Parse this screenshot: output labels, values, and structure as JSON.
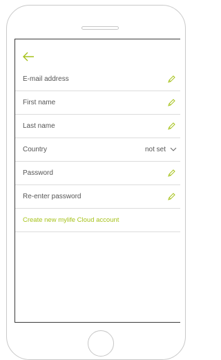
{
  "accent_color": "#a6c21a",
  "header": {
    "back_icon": "arrow-left-icon"
  },
  "form": {
    "fields": [
      {
        "label": "E-mail address",
        "icon": "pencil-icon"
      },
      {
        "label": "First name",
        "icon": "pencil-icon"
      },
      {
        "label": "Last name",
        "icon": "pencil-icon"
      },
      {
        "label": "Country",
        "value": "not set",
        "icon": "chevron-down-icon"
      },
      {
        "label": "Password",
        "icon": "pencil-icon"
      },
      {
        "label": "Re-enter password",
        "icon": "pencil-icon"
      }
    ],
    "create_link": "Create new mylife Cloud account"
  }
}
